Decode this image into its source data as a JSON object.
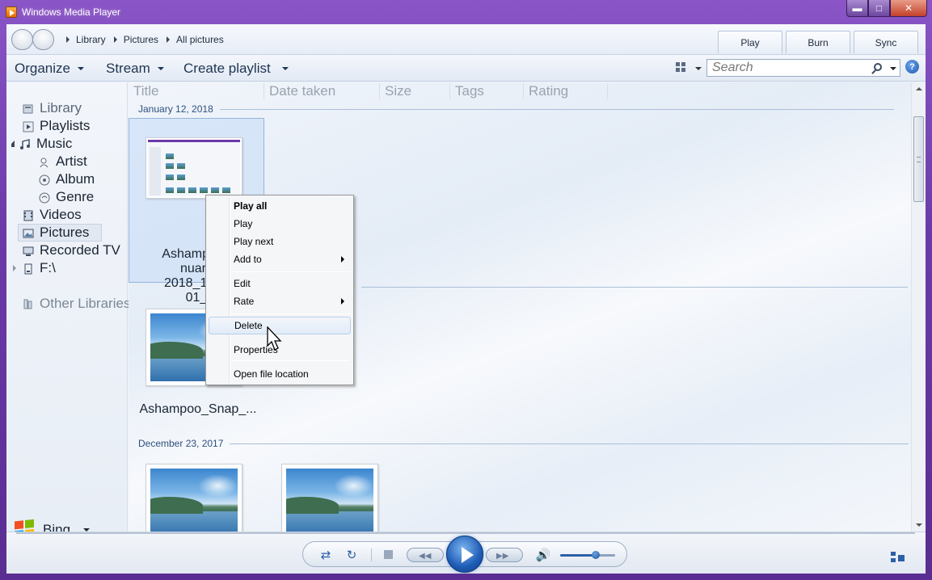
{
  "window": {
    "title": "Windows Media Player"
  },
  "breadcrumb": [
    "Library",
    "Pictures",
    "All pictures"
  ],
  "tabs": {
    "play": "Play",
    "burn": "Burn",
    "sync": "Sync"
  },
  "toolbar": {
    "organize": "Organize",
    "stream": "Stream",
    "create_playlist": "Create playlist",
    "search_placeholder": "Search",
    "help": "?"
  },
  "sidebar": {
    "items": [
      {
        "label": "Library",
        "icon": "library-icon"
      },
      {
        "label": "Playlists",
        "icon": "playlist-icon"
      },
      {
        "label": "Music",
        "icon": "music-icon"
      },
      {
        "label": "Artist",
        "icon": "artist-icon"
      },
      {
        "label": "Album",
        "icon": "album-icon"
      },
      {
        "label": "Genre",
        "icon": "genre-icon"
      },
      {
        "label": "Videos",
        "icon": "video-icon"
      },
      {
        "label": "Pictures",
        "icon": "picture-icon"
      },
      {
        "label": "Recorded TV",
        "icon": "tv-icon"
      },
      {
        "label": "F:\\",
        "icon": "drive-icon"
      },
      {
        "label": "Other Libraries",
        "icon": "other-libraries-icon"
      }
    ],
    "bing": "Bing",
    "selected": "Pictures"
  },
  "columns": [
    "Title",
    "Date taken",
    "Size",
    "Tags",
    "Rating"
  ],
  "groups": [
    {
      "date": "January 12, 2018",
      "items": [
        {
          "caption": "Ashampoo_\nnuary\n2018_13h0\n01_"
        },
        {
          "caption": "Ashampoo_Snap_..."
        }
      ]
    },
    {
      "date": "December 23, 2017",
      "items": []
    }
  ],
  "context_menu": {
    "items": [
      "Play all",
      "Play",
      "Play next",
      "Add to",
      "Edit",
      "Rate",
      "Delete",
      "Properties",
      "Open file location"
    ],
    "highlighted": "Delete"
  },
  "colors": {
    "frame": "#6c3aa8",
    "accent": "#2c5fa6",
    "group_header": "#2d4f7c"
  },
  "volume": {
    "level": 0.65
  }
}
